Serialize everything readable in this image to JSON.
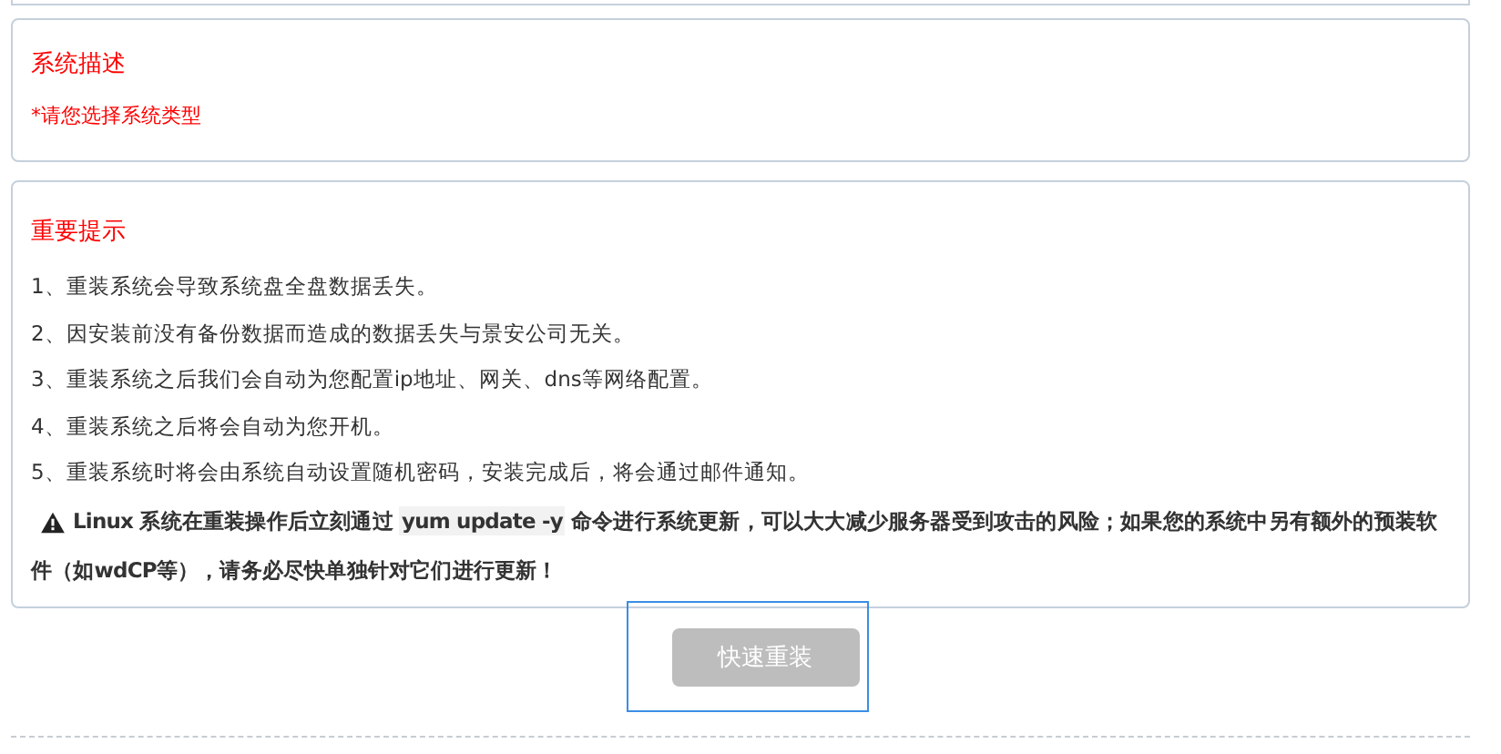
{
  "description": {
    "title": "系统描述",
    "hint": "*请您选择系统类型"
  },
  "notice": {
    "title": "重要提示",
    "items": [
      "1、重装系统会导致系统盘全盘数据丢失。",
      "2、因安装前没有备份数据而造成的数据丢失与景安公司无关。",
      "3、重装系统之后我们会自动为您配置ip地址、网关、dns等网络配置。",
      "4、重装系统之后将会自动为您开机。",
      "5、重装系统时将会由系统自动设置随机密码，安装完成后，将会通过邮件通知。"
    ],
    "warning": {
      "before": "Linux 系统在重装操作后立刻通过 ",
      "code": "yum update -y",
      "after": " 命令进行系统更新，可以大大减少服务器受到攻击的风险；如果您的系统中另有额外的预装软件（如wdCP等），请务必尽快单独针对它们进行更新！"
    }
  },
  "button": {
    "label": "快速重装",
    "disabled": true,
    "focused": true
  }
}
